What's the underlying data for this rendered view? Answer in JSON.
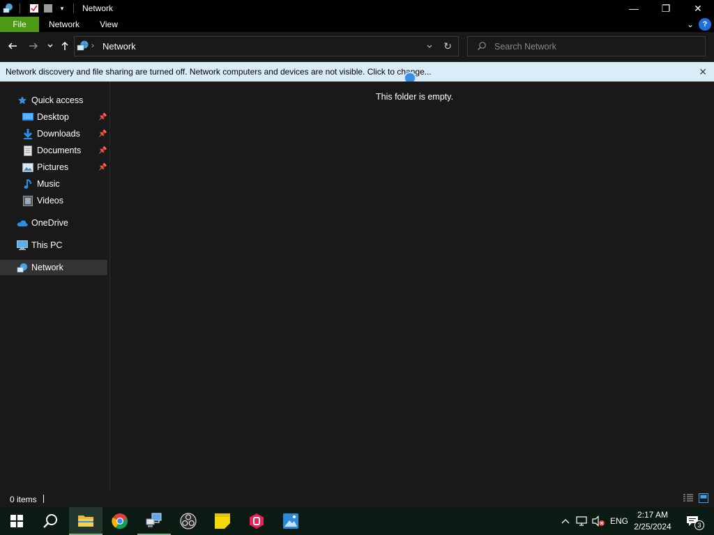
{
  "window": {
    "title": "Network",
    "controls": {
      "minimize": "—",
      "maximize": "❐",
      "close": "✕"
    }
  },
  "ribbon": {
    "tabs": [
      {
        "label": "File",
        "active": true
      },
      {
        "label": "Network"
      },
      {
        "label": "View"
      }
    ]
  },
  "address": {
    "location_icon": "network-icon",
    "breadcrumb": "Network",
    "search_placeholder": "Search Network"
  },
  "infobar": {
    "message": "Network discovery and file sharing are turned off. Network computers and devices are not visible. Click to change..."
  },
  "nav": {
    "quick_access": "Quick access",
    "quick_items": [
      {
        "label": "Desktop",
        "icon": "desktop-folder-icon",
        "pinned": true
      },
      {
        "label": "Downloads",
        "icon": "downloads-folder-icon",
        "pinned": true
      },
      {
        "label": "Documents",
        "icon": "documents-folder-icon",
        "pinned": true
      },
      {
        "label": "Pictures",
        "icon": "pictures-folder-icon",
        "pinned": true
      },
      {
        "label": "Music",
        "icon": "music-folder-icon",
        "pinned": false
      },
      {
        "label": "Videos",
        "icon": "videos-folder-icon",
        "pinned": false
      }
    ],
    "onedrive": "OneDrive",
    "thispc": "This PC",
    "network": "Network",
    "selected": "Network"
  },
  "content": {
    "empty_message": "This folder is empty."
  },
  "status": {
    "item_count": "0 items"
  },
  "taskbar": {
    "apps": [
      "start-icon",
      "search-icon",
      "file-explorer-icon",
      "chrome-icon",
      "network-app-icon",
      "obs-icon",
      "sticky-notes-icon",
      "app-red-icon",
      "photos-icon"
    ],
    "tray": {
      "language": "ENG",
      "time": "2:17 AM",
      "date": "2/25/2024",
      "notifications": "3"
    }
  },
  "colors": {
    "accent_file_tab": "#4c9a16",
    "infobar_bg": "#d9ecf7",
    "window_bg": "#191919",
    "titlebar_bg": "#000000",
    "taskbar_bg": "#0b1a12"
  }
}
